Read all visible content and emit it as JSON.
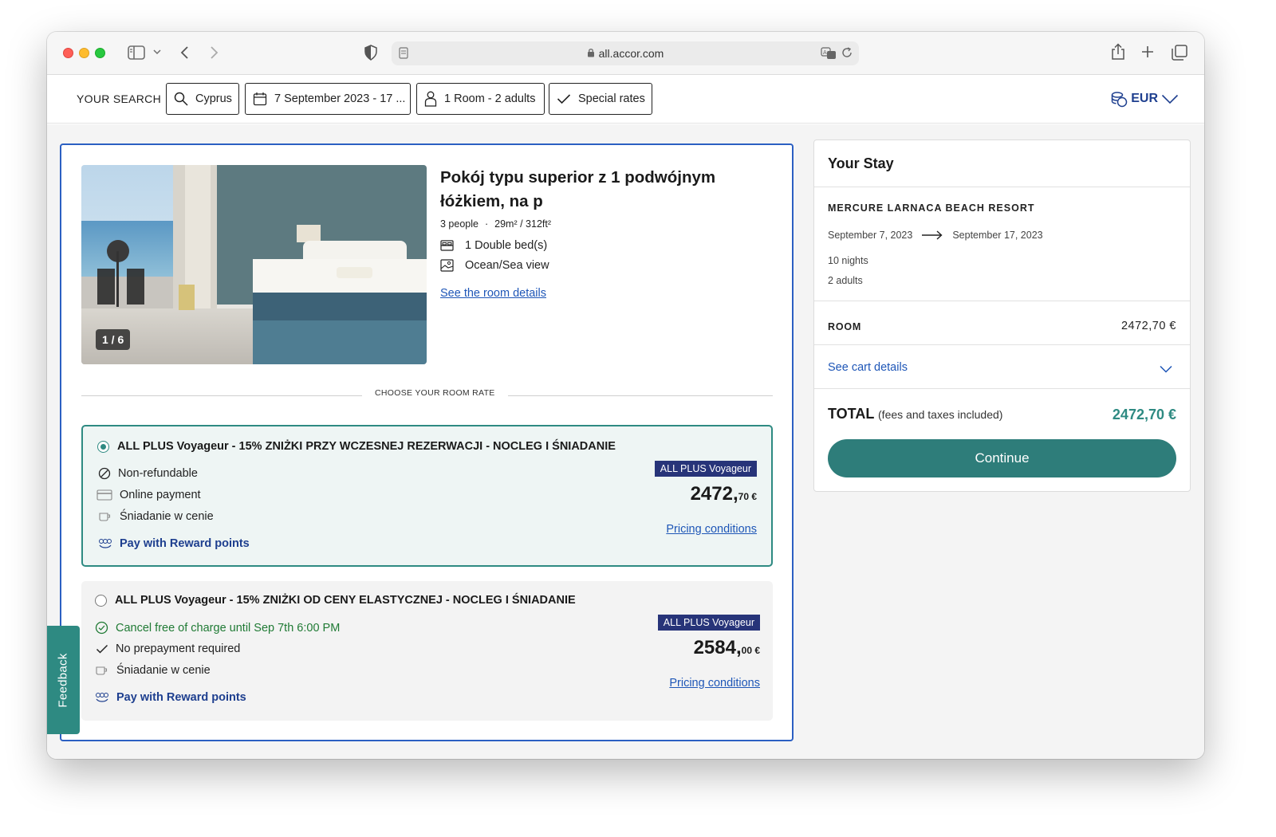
{
  "browser": {
    "url": "all.accor.com"
  },
  "search": {
    "label": "YOUR SEARCH",
    "destination": "Cyprus",
    "dates": "7 September 2023 - 17 ...",
    "guests": "1 Room - 2 adults",
    "rates": "Special rates",
    "currency": "EUR"
  },
  "room": {
    "photo_counter": "1 / 6",
    "title": "Pokój typu superior z 1 podwójnym łóżkiem, na p",
    "people": "3 people",
    "separator": "·",
    "size": "29m² / 312ft²",
    "bed": "1 Double bed(s)",
    "view": "Ocean/Sea view",
    "details_link": "See the room details"
  },
  "rates": {
    "section_label": "CHOOSE YOUR ROOM RATE",
    "items": [
      {
        "title": "ALL PLUS Voyageur - 15% ZNIŻKI PRZY WCZESNEJ REZERWACJI - NOCLEG I ŚNIADANIE",
        "line1": "Non-refundable",
        "line2": "Online payment",
        "line3": "Śniadanie w cenie",
        "reward": "Pay with Reward points",
        "badge": "ALL PLUS Voyageur",
        "price_main": "2472,",
        "price_cents": "70 €",
        "pricing_link": "Pricing conditions",
        "selected": true
      },
      {
        "title": "ALL PLUS Voyageur - 15% ZNIŻKI OD CENY ELASTYCZNEJ - NOCLEG I ŚNIADANIE",
        "line1": "Cancel free of charge until Sep 7th 6:00 PM",
        "line2": "No prepayment required",
        "line3": "Śniadanie w cenie",
        "reward": "Pay with Reward points",
        "badge": "ALL PLUS Voyageur",
        "price_main": "2584,",
        "price_cents": "00 €",
        "pricing_link": "Pricing conditions",
        "selected": false
      }
    ]
  },
  "feedback": {
    "label": "Feedback"
  },
  "stay": {
    "heading": "Your Stay",
    "hotel": "MERCURE LARNACA BEACH RESORT",
    "checkin": "September 7, 2023",
    "checkout": "September 17, 2023",
    "nights": "10 nights",
    "adults": "2 adults",
    "room_label": "ROOM",
    "room_price": "2472,70 €",
    "cart_link": "See cart details",
    "total_label": "TOTAL",
    "total_note": "(fees and taxes included)",
    "total_value": "2472,70 €",
    "continue_label": "Continue"
  },
  "colors": {
    "accent_teal": "#2e8a82",
    "link_blue": "#1e56b7",
    "badge_navy": "#273479",
    "card_border": "#2b5fc2"
  }
}
